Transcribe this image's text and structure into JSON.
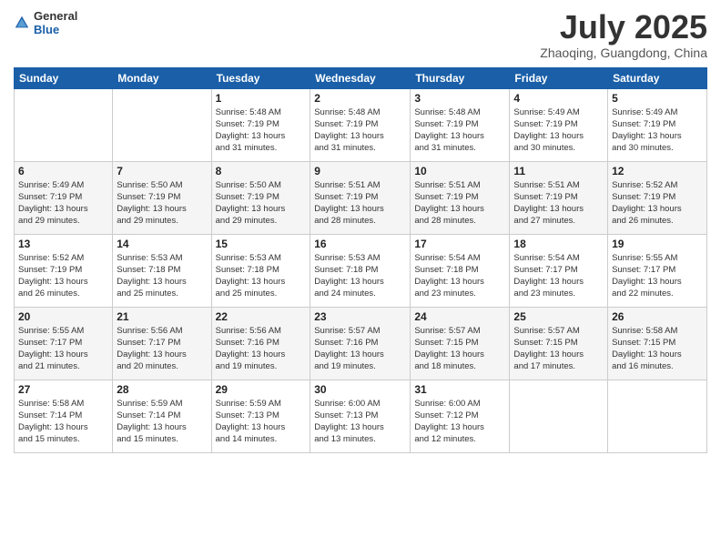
{
  "header": {
    "logo": {
      "general": "General",
      "blue": "Blue"
    },
    "title": "July 2025",
    "location": "Zhaoqing, Guangdong, China"
  },
  "weekdays": [
    "Sunday",
    "Monday",
    "Tuesday",
    "Wednesday",
    "Thursday",
    "Friday",
    "Saturday"
  ],
  "weeks": [
    [
      {
        "day": "",
        "info": ""
      },
      {
        "day": "",
        "info": ""
      },
      {
        "day": "1",
        "info": "Sunrise: 5:48 AM\nSunset: 7:19 PM\nDaylight: 13 hours\nand 31 minutes."
      },
      {
        "day": "2",
        "info": "Sunrise: 5:48 AM\nSunset: 7:19 PM\nDaylight: 13 hours\nand 31 minutes."
      },
      {
        "day": "3",
        "info": "Sunrise: 5:48 AM\nSunset: 7:19 PM\nDaylight: 13 hours\nand 31 minutes."
      },
      {
        "day": "4",
        "info": "Sunrise: 5:49 AM\nSunset: 7:19 PM\nDaylight: 13 hours\nand 30 minutes."
      },
      {
        "day": "5",
        "info": "Sunrise: 5:49 AM\nSunset: 7:19 PM\nDaylight: 13 hours\nand 30 minutes."
      }
    ],
    [
      {
        "day": "6",
        "info": "Sunrise: 5:49 AM\nSunset: 7:19 PM\nDaylight: 13 hours\nand 29 minutes."
      },
      {
        "day": "7",
        "info": "Sunrise: 5:50 AM\nSunset: 7:19 PM\nDaylight: 13 hours\nand 29 minutes."
      },
      {
        "day": "8",
        "info": "Sunrise: 5:50 AM\nSunset: 7:19 PM\nDaylight: 13 hours\nand 29 minutes."
      },
      {
        "day": "9",
        "info": "Sunrise: 5:51 AM\nSunset: 7:19 PM\nDaylight: 13 hours\nand 28 minutes."
      },
      {
        "day": "10",
        "info": "Sunrise: 5:51 AM\nSunset: 7:19 PM\nDaylight: 13 hours\nand 28 minutes."
      },
      {
        "day": "11",
        "info": "Sunrise: 5:51 AM\nSunset: 7:19 PM\nDaylight: 13 hours\nand 27 minutes."
      },
      {
        "day": "12",
        "info": "Sunrise: 5:52 AM\nSunset: 7:19 PM\nDaylight: 13 hours\nand 26 minutes."
      }
    ],
    [
      {
        "day": "13",
        "info": "Sunrise: 5:52 AM\nSunset: 7:19 PM\nDaylight: 13 hours\nand 26 minutes."
      },
      {
        "day": "14",
        "info": "Sunrise: 5:53 AM\nSunset: 7:18 PM\nDaylight: 13 hours\nand 25 minutes."
      },
      {
        "day": "15",
        "info": "Sunrise: 5:53 AM\nSunset: 7:18 PM\nDaylight: 13 hours\nand 25 minutes."
      },
      {
        "day": "16",
        "info": "Sunrise: 5:53 AM\nSunset: 7:18 PM\nDaylight: 13 hours\nand 24 minutes."
      },
      {
        "day": "17",
        "info": "Sunrise: 5:54 AM\nSunset: 7:18 PM\nDaylight: 13 hours\nand 23 minutes."
      },
      {
        "day": "18",
        "info": "Sunrise: 5:54 AM\nSunset: 7:17 PM\nDaylight: 13 hours\nand 23 minutes."
      },
      {
        "day": "19",
        "info": "Sunrise: 5:55 AM\nSunset: 7:17 PM\nDaylight: 13 hours\nand 22 minutes."
      }
    ],
    [
      {
        "day": "20",
        "info": "Sunrise: 5:55 AM\nSunset: 7:17 PM\nDaylight: 13 hours\nand 21 minutes."
      },
      {
        "day": "21",
        "info": "Sunrise: 5:56 AM\nSunset: 7:17 PM\nDaylight: 13 hours\nand 20 minutes."
      },
      {
        "day": "22",
        "info": "Sunrise: 5:56 AM\nSunset: 7:16 PM\nDaylight: 13 hours\nand 19 minutes."
      },
      {
        "day": "23",
        "info": "Sunrise: 5:57 AM\nSunset: 7:16 PM\nDaylight: 13 hours\nand 19 minutes."
      },
      {
        "day": "24",
        "info": "Sunrise: 5:57 AM\nSunset: 7:15 PM\nDaylight: 13 hours\nand 18 minutes."
      },
      {
        "day": "25",
        "info": "Sunrise: 5:57 AM\nSunset: 7:15 PM\nDaylight: 13 hours\nand 17 minutes."
      },
      {
        "day": "26",
        "info": "Sunrise: 5:58 AM\nSunset: 7:15 PM\nDaylight: 13 hours\nand 16 minutes."
      }
    ],
    [
      {
        "day": "27",
        "info": "Sunrise: 5:58 AM\nSunset: 7:14 PM\nDaylight: 13 hours\nand 15 minutes."
      },
      {
        "day": "28",
        "info": "Sunrise: 5:59 AM\nSunset: 7:14 PM\nDaylight: 13 hours\nand 15 minutes."
      },
      {
        "day": "29",
        "info": "Sunrise: 5:59 AM\nSunset: 7:13 PM\nDaylight: 13 hours\nand 14 minutes."
      },
      {
        "day": "30",
        "info": "Sunrise: 6:00 AM\nSunset: 7:13 PM\nDaylight: 13 hours\nand 13 minutes."
      },
      {
        "day": "31",
        "info": "Sunrise: 6:00 AM\nSunset: 7:12 PM\nDaylight: 13 hours\nand 12 minutes."
      },
      {
        "day": "",
        "info": ""
      },
      {
        "day": "",
        "info": ""
      }
    ]
  ]
}
